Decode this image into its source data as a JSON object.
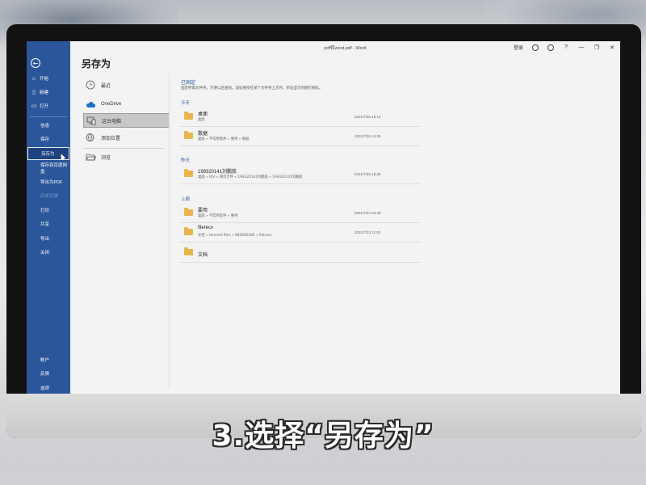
{
  "window": {
    "doc_title": "pdf转word.pdf - Word",
    "login_label": "登录",
    "help_label": "?",
    "minimize_glyph": "—",
    "restore_glyph": "❐",
    "close_glyph": "✕"
  },
  "nav": {
    "back_icon": "back-arrow-icon",
    "top_items": [
      {
        "label": "开始",
        "icon": "home-icon"
      },
      {
        "label": "新建",
        "icon": "new-doc-icon"
      },
      {
        "label": "打开",
        "icon": "folder-open-icon"
      }
    ],
    "items": [
      {
        "label": "信息"
      },
      {
        "label": "保存"
      },
      {
        "label": "另存为",
        "selected": true
      },
      {
        "label": "保存到百度网盘"
      },
      {
        "label": "导出为PDF"
      },
      {
        "label": "历史记录",
        "disabled": true
      },
      {
        "label": "打印"
      },
      {
        "label": "共享"
      },
      {
        "label": "导出"
      },
      {
        "label": "关闭"
      }
    ],
    "bottom_items": [
      {
        "label": "帐户"
      },
      {
        "label": "反馈"
      },
      {
        "label": "选项"
      }
    ]
  },
  "page_title": "另存为",
  "locations": [
    {
      "label": "最近",
      "icon": "clock-icon"
    },
    {
      "label": "OneDrive",
      "icon": "cloud-icon"
    },
    {
      "label": "这台电脑",
      "icon": "computer-icon",
      "selected": true
    },
    {
      "label": "添加位置",
      "icon": "globe-add-icon"
    },
    {
      "label": "浏览",
      "icon": "folder-browse-icon"
    }
  ],
  "pinned": {
    "heading": "已固定",
    "description": "固定所需文件夹，方便以后查找。鼠标悬停在某个文件夹上方时，单击显示的图钉图标。"
  },
  "groups": [
    {
      "heading": "今天",
      "rows": [
        {
          "name": "桌面",
          "path": "桌面",
          "date": "2021/7/26 16:14"
        },
        {
          "name": "数据",
          "path": "桌面 » 不常用软件 » 要用 » 数据",
          "date": "2021/7/26 14:29"
        }
      ]
    },
    {
      "heading": "昨天",
      "rows": [
        {
          "name": "199320141刘鹏航",
          "path": "桌面 » DIV » 网页文件 » 199320141刘鹏航 » 199320141刘鹏航",
          "date": "2021/7/25 15:36"
        }
      ]
    },
    {
      "heading": "上周",
      "rows": [
        {
          "name": "要用",
          "path": "桌面 » 不常用软件 » 要用",
          "date": "2021/7/24 23:49"
        },
        {
          "name": "filerecv",
          "path": "文档 » tencent files » 985806286 » filerecv",
          "date": "2021/7/23 11:02"
        },
        {
          "name": "文档",
          "path": "",
          "date": ""
        }
      ]
    }
  ],
  "caption": "3.选择“另存为”",
  "colors": {
    "nav_blue": "#2b579a",
    "accent_text": "#2b579a",
    "folder": "#e8b54d"
  }
}
